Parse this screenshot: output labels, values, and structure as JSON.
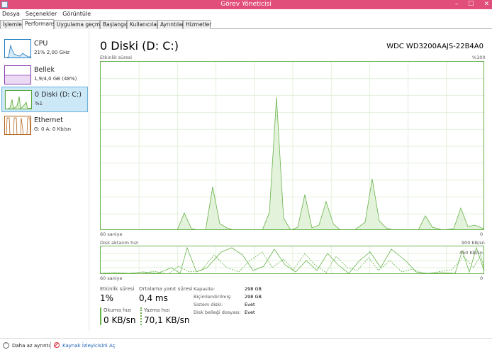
{
  "window": {
    "title": "Görev Yöneticisi",
    "minimize": "–",
    "maximize": "☐",
    "close": "✕"
  },
  "menu": [
    "Dosya",
    "Seçenekler",
    "Görüntüle"
  ],
  "tabs": [
    "İşlemler",
    "Performans",
    "Uygulama geçmişi",
    "Başlangıç",
    "Kullanıcılar",
    "Ayrıntılar",
    "Hizmetler"
  ],
  "sidebar": [
    {
      "name": "CPU",
      "sub": "21% 2,00 GHz",
      "color": "#1a7ac4"
    },
    {
      "name": "Bellek",
      "sub": "1,9/4,0 GB (48%)",
      "color": "#8b3fb0"
    },
    {
      "name": "0 Diski (D: C:)",
      "sub": "%1",
      "color": "#5aa838"
    },
    {
      "name": "Ethernet",
      "sub": "G: 0 A: 0 Kb/sn",
      "color": "#b5651d"
    }
  ],
  "main": {
    "title": "0 Diski (D: C:)",
    "device": "WDC WD3200AAJS-22B4A0",
    "activity_label": "Etkinlik süresi",
    "activity_max": "%100",
    "activity_time": "60 saniye",
    "activity_min": "0",
    "transfer_label": "Disk aktarım hızı",
    "transfer_max": "900 KB/sn",
    "transfer_mid": "450 KB/sn",
    "transfer_time": "60 saniye",
    "transfer_min": "0"
  },
  "stats": {
    "activity_label": "Etkinlik süresi",
    "activity_value": "1%",
    "response_label": "Ortalama yanıt süresi",
    "response_value": "0,4 ms",
    "read_label": "Okuma hızı",
    "read_value": "0 KB/sn",
    "write_label": "Yazma hızı",
    "write_value": "70,1 KB/sn",
    "capacity_label": "Kapasite:",
    "capacity_value": "298 GB",
    "formatted_label": "Biçimlendirilmiş:",
    "formatted_value": "298 GB",
    "system_label": "Sistem diski:",
    "system_value": "Evet",
    "pagefile_label": "Disk belleği dosyası:",
    "pagefile_value": "Evet"
  },
  "footer": {
    "less": "Daha az ayrıntı",
    "resmon": "Kaynak İzleyicisini Aç"
  },
  "colors": {
    "title_bar": "#e14e7a",
    "disk_green": "#68b34a",
    "link_blue": "#1a5fb4"
  }
}
